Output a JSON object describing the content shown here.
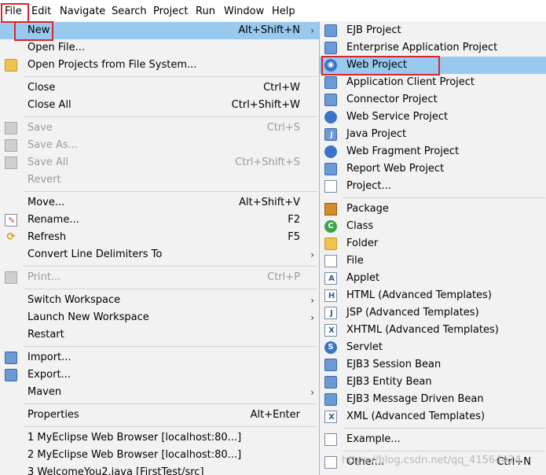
{
  "menubar": {
    "items": [
      "File",
      "Edit",
      "Navigate",
      "Search",
      "Project",
      "Run",
      "Window",
      "Help"
    ]
  },
  "file_menu": {
    "items": [
      {
        "label": "New",
        "accel": "Alt+Shift+N",
        "submenu": true,
        "highlighted": true,
        "icon": "none"
      },
      {
        "label": "Open File...",
        "icon": "none"
      },
      {
        "label": "Open Projects from File System...",
        "icon": "folder-icon"
      },
      {
        "label": "Close",
        "accel": "Ctrl+W"
      },
      {
        "label": "Close All",
        "accel": "Ctrl+Shift+W"
      },
      {
        "label": "Save",
        "accel": "Ctrl+S",
        "disabled": true,
        "icon": "save-icon"
      },
      {
        "label": "Save As...",
        "disabled": true,
        "icon": "save-as-icon"
      },
      {
        "label": "Save All",
        "accel": "Ctrl+Shift+S",
        "disabled": true,
        "icon": "save-all-icon"
      },
      {
        "label": "Revert",
        "disabled": true
      },
      {
        "label": "Move...",
        "accel": "Alt+Shift+V"
      },
      {
        "label": "Rename...",
        "accel": "F2",
        "icon": "rename-icon"
      },
      {
        "label": "Refresh",
        "accel": "F5",
        "icon": "refresh-icon"
      },
      {
        "label": "Convert Line Delimiters To",
        "submenu": true
      },
      {
        "label": "Print...",
        "accel": "Ctrl+P",
        "disabled": true,
        "icon": "print-icon"
      },
      {
        "label": "Switch Workspace",
        "submenu": true
      },
      {
        "label": "Launch New Workspace",
        "submenu": true
      },
      {
        "label": "Restart"
      },
      {
        "label": "Import...",
        "icon": "import-icon"
      },
      {
        "label": "Export...",
        "icon": "export-icon"
      },
      {
        "label": "Maven",
        "submenu": true
      },
      {
        "label": "Properties",
        "accel": "Alt+Enter"
      },
      {
        "label": "1 MyEclipse Web Browser  [localhost:80...]"
      },
      {
        "label": "2 MyEclipse Web Browser  [localhost:80...]"
      },
      {
        "label": "3 WelcomeYou2.java  [FirstTest/src]"
      }
    ]
  },
  "new_submenu": {
    "items": [
      {
        "label": "EJB Project",
        "icon": "ejb-project-icon"
      },
      {
        "label": "Enterprise Application Project",
        "icon": "enterprise-project-icon"
      },
      {
        "label": "Web Project",
        "icon": "web-project-icon",
        "highlighted": true
      },
      {
        "label": "Application Client Project",
        "icon": "app-client-project-icon"
      },
      {
        "label": "Connector Project",
        "icon": "connector-project-icon"
      },
      {
        "label": "Web Service Project",
        "icon": "web-service-project-icon"
      },
      {
        "label": "Java Project",
        "icon": "java-project-icon"
      },
      {
        "label": "Web Fragment Project",
        "icon": "web-fragment-project-icon"
      },
      {
        "label": "Report Web Project",
        "icon": "report-web-project-icon"
      },
      {
        "label": "Project...",
        "icon": "project-icon"
      },
      {
        "label": "Package",
        "icon": "package-icon"
      },
      {
        "label": "Class",
        "icon": "class-icon"
      },
      {
        "label": "Folder",
        "icon": "folder-icon"
      },
      {
        "label": "File",
        "icon": "file-icon"
      },
      {
        "label": "Applet",
        "icon": "applet-icon"
      },
      {
        "label": "HTML (Advanced Templates)",
        "icon": "html-icon"
      },
      {
        "label": "JSP (Advanced Templates)",
        "icon": "jsp-icon"
      },
      {
        "label": "XHTML (Advanced Templates)",
        "icon": "xhtml-icon"
      },
      {
        "label": "Servlet",
        "icon": "servlet-icon"
      },
      {
        "label": "EJB3 Session Bean",
        "icon": "ejb3-session-bean-icon"
      },
      {
        "label": "EJB3 Entity Bean",
        "icon": "ejb3-entity-bean-icon"
      },
      {
        "label": "EJB3 Message Driven Bean",
        "icon": "ejb3-mdb-icon"
      },
      {
        "label": "XML (Advanced Templates)",
        "icon": "xml-icon"
      },
      {
        "label": "Example...",
        "icon": "example-icon"
      },
      {
        "label": "Other...",
        "accel": "Ctrl+N",
        "icon": "other-icon"
      }
    ]
  },
  "watermark": "https://blog.csdn.net/qq_41564424",
  "colors": {
    "highlight": "#99c9ef",
    "annotation_box": "#d9262c",
    "menu_bg": "#f2f2f2"
  }
}
